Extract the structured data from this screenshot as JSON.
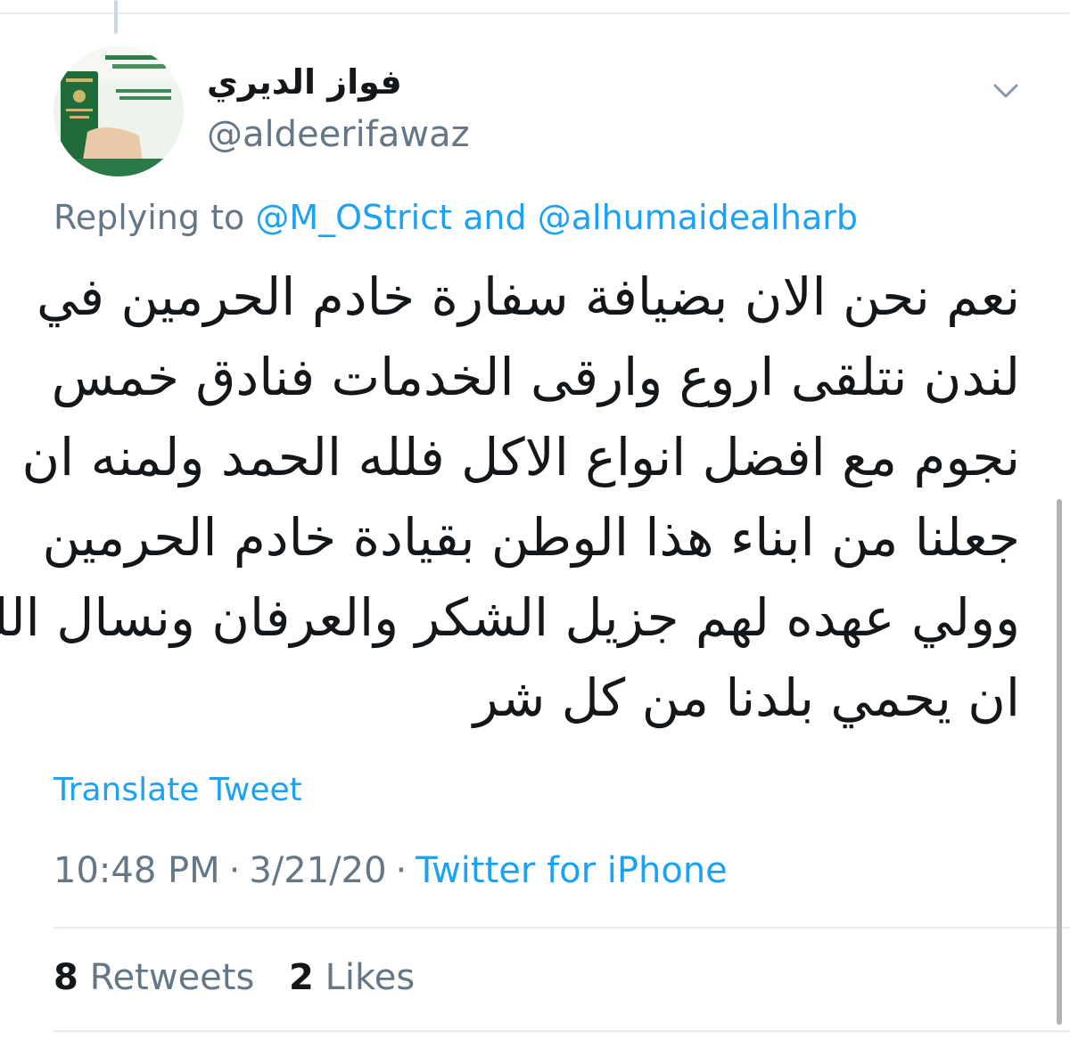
{
  "user": {
    "display_name": "فواز الديري",
    "handle": "@aldeerifawaz",
    "avatar_icon": "avatar-passport-image"
  },
  "reply": {
    "prefix": "Replying to",
    "mention_1": "@M_OStrict",
    "conjunction": "and",
    "mention_2": "@alhumaidealharb"
  },
  "tweet": {
    "lines": [
      "نعم نحن الان بضيافة سفارة خادم الحرمين في",
      "لندن نتلقى اروع وارقى الخدمات فنادق خمس",
      "نجوم مع افضل انواع الاكل فلله الحمد ولمنه ان",
      "جعلنا من ابناء هذا الوطن بقيادة خادم الحرمين",
      "وولي عهده لهم جزيل الشكر والعرفان ونسال الله",
      "ان يحمي بلدنا من كل شر"
    ]
  },
  "translate_label": "Translate Tweet",
  "meta": {
    "time": "10:48 PM",
    "separator": "·",
    "date": "3/21/20",
    "source": "Twitter for iPhone"
  },
  "stats": {
    "retweets_count": "8",
    "retweets_label": "Retweets",
    "likes_count": "2",
    "likes_label": "Likes"
  },
  "colors": {
    "link": "#1da1f2",
    "secondary_text": "#657786",
    "primary_text": "#14171a",
    "divider": "#e6ecf0"
  },
  "icons": {
    "caret": "chevron-down-icon"
  }
}
